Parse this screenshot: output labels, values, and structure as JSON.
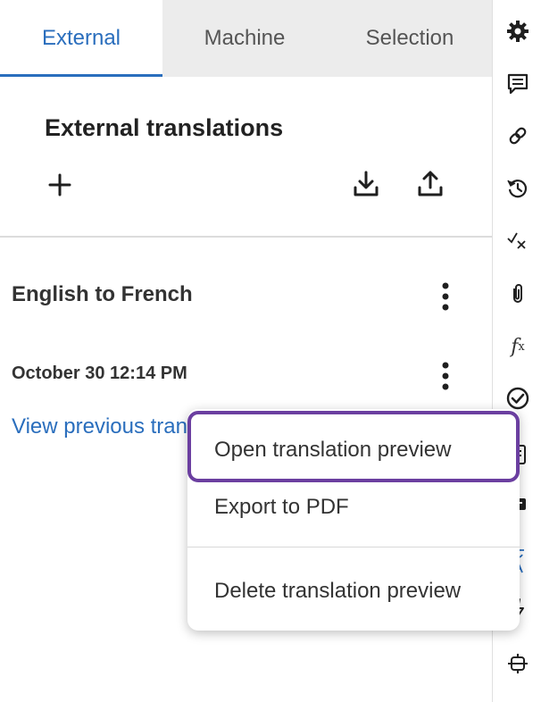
{
  "tabs": {
    "external": "External",
    "machine": "Machine",
    "selection": "Selection"
  },
  "panel": {
    "title": "External translations"
  },
  "entry": {
    "title": "English to French",
    "date": "October 30 12:14 PM",
    "view_previous": "View previous translations"
  },
  "menu": {
    "items": [
      "Open translation preview",
      "Export to PDF",
      "Delete translation preview"
    ]
  },
  "rail": {
    "icons": [
      "gear-icon",
      "comment-icon",
      "link-icon",
      "history-icon",
      "check-x-icon",
      "paperclip-icon",
      "function-icon",
      "check-circle-icon",
      "clipboard-icon",
      "message-card-icon",
      "translate-icon",
      "lightning-icon",
      "integrations-icon"
    ]
  },
  "colors": {
    "accent": "#2a6ebd",
    "focus": "#6b3fa0",
    "tab_bar": "#ececec"
  }
}
